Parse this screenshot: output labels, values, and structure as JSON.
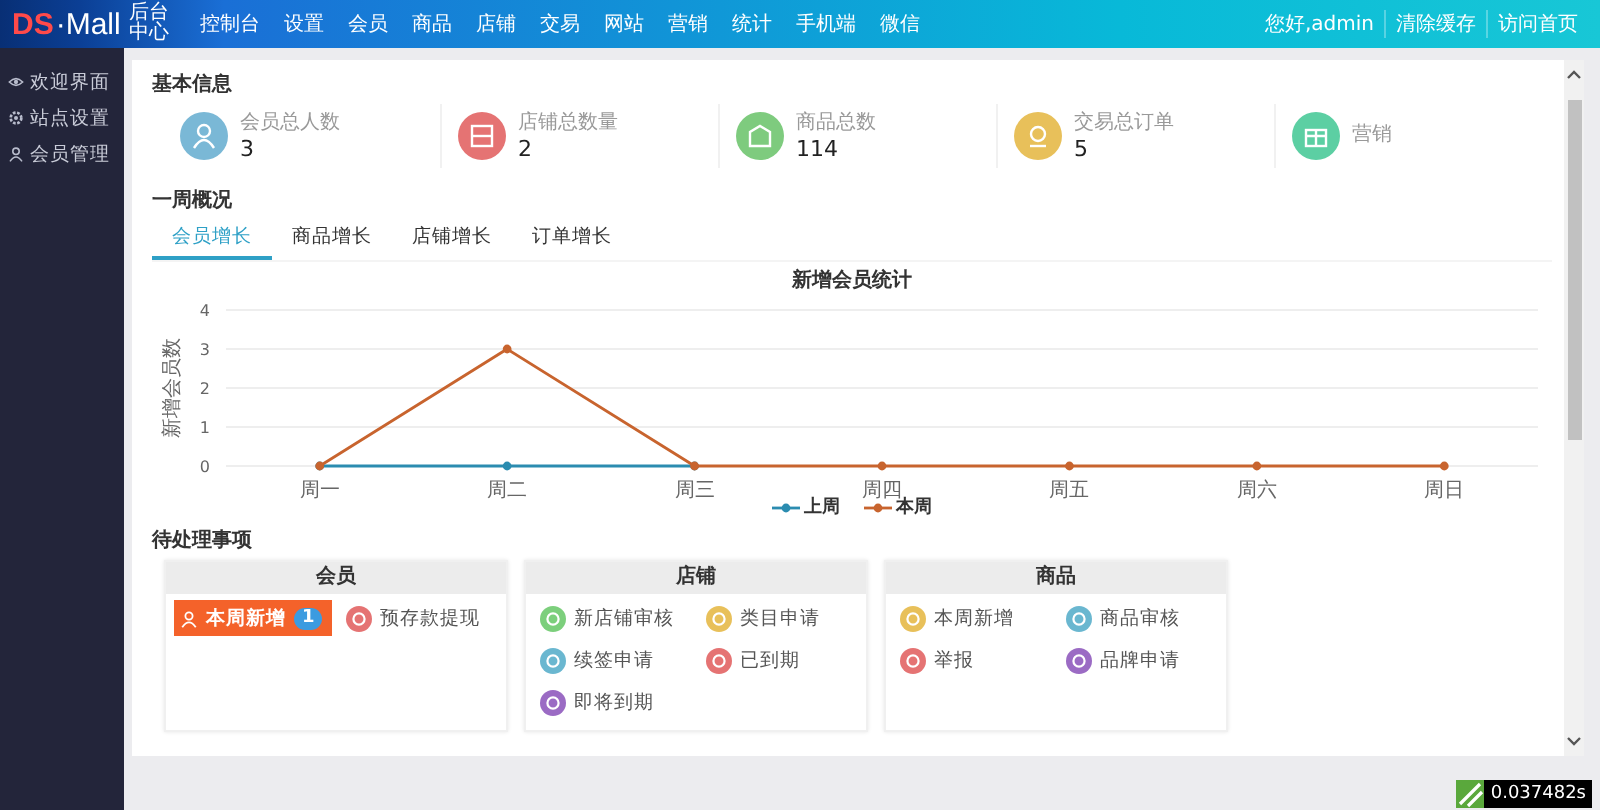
{
  "header": {
    "logo": {
      "mark": "DS",
      "name": "·Mall",
      "subtitle": "后台中心"
    },
    "nav": [
      {
        "label": "控制台"
      },
      {
        "label": "设置"
      },
      {
        "label": "会员"
      },
      {
        "label": "商品"
      },
      {
        "label": "店铺"
      },
      {
        "label": "交易"
      },
      {
        "label": "网站"
      },
      {
        "label": "营销"
      },
      {
        "label": "统计"
      },
      {
        "label": "手机端"
      },
      {
        "label": "微信"
      }
    ],
    "links": [
      "您好,admin",
      "清除缓存",
      "访问首页"
    ]
  },
  "sidebar": {
    "items": [
      {
        "label": "欢迎界面",
        "kind": "eye"
      },
      {
        "label": "站点设置",
        "kind": "gear"
      },
      {
        "label": "会员管理",
        "kind": "user"
      }
    ]
  },
  "basic_info": {
    "title": "基本信息",
    "cards": [
      {
        "label": "会员总人数",
        "value": "3",
        "kind": "user",
        "color": "#7ab8d6"
      },
      {
        "label": "店铺总数量",
        "value": "2",
        "kind": "store",
        "color": "#e57373"
      },
      {
        "label": "商品总数",
        "value": "114",
        "kind": "bag",
        "color": "#7ecb7e"
      },
      {
        "label": "交易总订单",
        "value": "5",
        "kind": "order",
        "color": "#e8c05a"
      },
      {
        "label": "营销",
        "kind": "gift",
        "color": "#5ccfa3"
      }
    ]
  },
  "weekly": {
    "title": "一周概况",
    "tabs": [
      {
        "label": "会员增长",
        "selected": true
      },
      {
        "label": "商品增长",
        "selected": false
      },
      {
        "label": "店铺增长",
        "selected": false
      },
      {
        "label": "订单增长",
        "selected": false
      }
    ],
    "chart_data": {
      "type": "line",
      "title": "新增会员统计",
      "ylabel": "新增会员数",
      "categories": [
        "周一",
        "周二",
        "周三",
        "周四",
        "周五",
        "周六",
        "周日"
      ],
      "ylim": [
        0,
        4
      ],
      "yticks": [
        0,
        1,
        2,
        3,
        4
      ],
      "grid": true,
      "legend": "bottom",
      "series": [
        {
          "name": "上周",
          "color": "#2b8cb0",
          "marker": "circle",
          "values": [
            0,
            0,
            0,
            null,
            null,
            null,
            null
          ]
        },
        {
          "name": "本周",
          "color": "#c8642e",
          "marker": "circle",
          "values": [
            0,
            3,
            0,
            0,
            0,
            0,
            0
          ]
        }
      ]
    }
  },
  "pending": {
    "title": "待处理事项",
    "groups": [
      {
        "title": "会员",
        "items": [
          {
            "label": "本周新增",
            "selected": true,
            "count": "1"
          },
          {
            "label": "预存款提现",
            "selected": false,
            "color": "#e57373"
          }
        ]
      },
      {
        "title": "店铺",
        "items": [
          {
            "label": "新店铺审核",
            "selected": false,
            "color": "#7ccf7c"
          },
          {
            "label": "类目申请",
            "selected": false,
            "color": "#e8c05a"
          },
          {
            "label": "续签申请",
            "selected": false,
            "color": "#6ab7d0"
          },
          {
            "label": "已到期",
            "selected": false,
            "color": "#e57373"
          },
          {
            "label": "即将到期",
            "selected": false,
            "color": "#9b6bc4"
          }
        ]
      },
      {
        "title": "商品",
        "items": [
          {
            "label": "本周新增",
            "selected": false,
            "color": "#e8c05a"
          },
          {
            "label": "商品审核",
            "selected": false,
            "color": "#6ab7d0"
          },
          {
            "label": "举报",
            "selected": false,
            "color": "#e57373"
          },
          {
            "label": "品牌申请",
            "selected": false,
            "color": "#9b6bc4"
          }
        ]
      }
    ]
  },
  "debug": {
    "time": "0.037482s"
  }
}
